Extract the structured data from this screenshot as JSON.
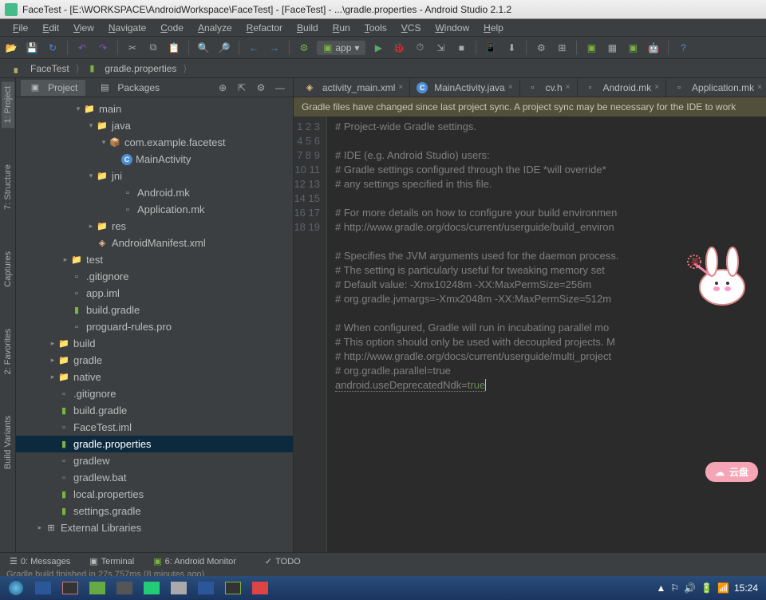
{
  "title": "FaceTest - [E:\\WORKSPACE\\AndroidWorkspace\\FaceTest] - [FaceTest] - ...\\gradle.properties - Android Studio 2.1.2",
  "menu": [
    "File",
    "Edit",
    "View",
    "Navigate",
    "Code",
    "Analyze",
    "Refactor",
    "Build",
    "Run",
    "Tools",
    "VCS",
    "Window",
    "Help"
  ],
  "run_config": "app",
  "breadcrumb": [
    {
      "icon": "folder",
      "label": "FaceTest"
    },
    {
      "icon": "grd",
      "label": "gradle.properties"
    }
  ],
  "left_tabs": [
    "1: Project",
    "7: Structure",
    "Captures",
    "2: Favorites",
    "Build Variants"
  ],
  "pane_tabs": [
    "Project",
    "Packages"
  ],
  "tree": [
    {
      "d": 4,
      "a": "▾",
      "i": "foldsrc",
      "t": "main"
    },
    {
      "d": 5,
      "a": "▾",
      "i": "foldsrc",
      "t": "java"
    },
    {
      "d": 6,
      "a": "▾",
      "i": "pkg",
      "t": "com.example.facetest"
    },
    {
      "d": 7,
      "a": "",
      "i": "cls",
      "t": "MainActivity",
      "ic": "C"
    },
    {
      "d": 5,
      "a": "▾",
      "i": "foldsrc",
      "t": "jni"
    },
    {
      "d": 7,
      "a": "",
      "i": "file",
      "t": "Android.mk"
    },
    {
      "d": 7,
      "a": "",
      "i": "file",
      "t": "Application.mk"
    },
    {
      "d": 5,
      "a": "▸",
      "i": "foldsrc",
      "t": "res"
    },
    {
      "d": 5,
      "a": "",
      "i": "xml",
      "t": "AndroidManifest.xml"
    },
    {
      "d": 3,
      "a": "▸",
      "i": "fold",
      "t": "test"
    },
    {
      "d": 3,
      "a": "",
      "i": "file",
      "t": ".gitignore"
    },
    {
      "d": 3,
      "a": "",
      "i": "file",
      "t": "app.iml"
    },
    {
      "d": 3,
      "a": "",
      "i": "grd",
      "t": "build.gradle"
    },
    {
      "d": 3,
      "a": "",
      "i": "file",
      "t": "proguard-rules.pro"
    },
    {
      "d": 2,
      "a": "▸",
      "i": "fold",
      "t": "build"
    },
    {
      "d": 2,
      "a": "▸",
      "i": "fold",
      "t": "gradle"
    },
    {
      "d": 2,
      "a": "▸",
      "i": "foldsrc",
      "t": "native"
    },
    {
      "d": 2,
      "a": "",
      "i": "file",
      "t": ".gitignore"
    },
    {
      "d": 2,
      "a": "",
      "i": "grd",
      "t": "build.gradle"
    },
    {
      "d": 2,
      "a": "",
      "i": "file",
      "t": "FaceTest.iml"
    },
    {
      "d": 2,
      "a": "",
      "i": "grd",
      "t": "gradle.properties",
      "sel": true
    },
    {
      "d": 2,
      "a": "",
      "i": "file",
      "t": "gradlew"
    },
    {
      "d": 2,
      "a": "",
      "i": "file",
      "t": "gradlew.bat"
    },
    {
      "d": 2,
      "a": "",
      "i": "grd",
      "t": "local.properties"
    },
    {
      "d": 2,
      "a": "",
      "i": "grd",
      "t": "settings.gradle"
    },
    {
      "d": 1,
      "a": "▸",
      "i": "lib",
      "t": "External Libraries"
    }
  ],
  "editor_tabs": [
    {
      "i": "xml",
      "t": "activity_main.xml"
    },
    {
      "i": "cls",
      "t": "MainActivity.java"
    },
    {
      "i": "file",
      "t": "cv.h"
    },
    {
      "i": "file",
      "t": "Android.mk"
    },
    {
      "i": "file",
      "t": "Application.mk"
    }
  ],
  "notification": "Gradle files have changed since last project sync. A project sync may be necessary for the IDE to work",
  "code_lines": [
    "# Project-wide Gradle settings.",
    "",
    "# IDE (e.g. Android Studio) users:",
    "# Gradle settings configured through the IDE *will override*",
    "# any settings specified in this file.",
    "",
    "# For more details on how to configure your build environmen",
    "# http://www.gradle.org/docs/current/userguide/build_environ",
    "",
    "# Specifies the JVM arguments used for the daemon process.",
    "# The setting is particularly useful for tweaking memory set",
    "# Default value: -Xmx10248m -XX:MaxPermSize=256m",
    "# org.gradle.jvmargs=-Xmx2048m -XX:MaxPermSize=512m",
    "",
    "# When configured, Gradle will run in incubating parallel mo",
    "# This option should only be used with decoupled projects. M",
    "# http://www.gradle.org/docs/current/userguide/multi_project",
    "# org.gradle.parallel=true"
  ],
  "code_line_19": {
    "key": "android.useDeprecatedNdk",
    "val": "true"
  },
  "bottom_tabs": [
    "0: Messages",
    "Terminal",
    "6: Android Monitor",
    "TODO"
  ],
  "status": "Gradle build finished in 27s 757ms (8 minutes ago)",
  "clock": "15:24",
  "cloud_label": "云盘"
}
